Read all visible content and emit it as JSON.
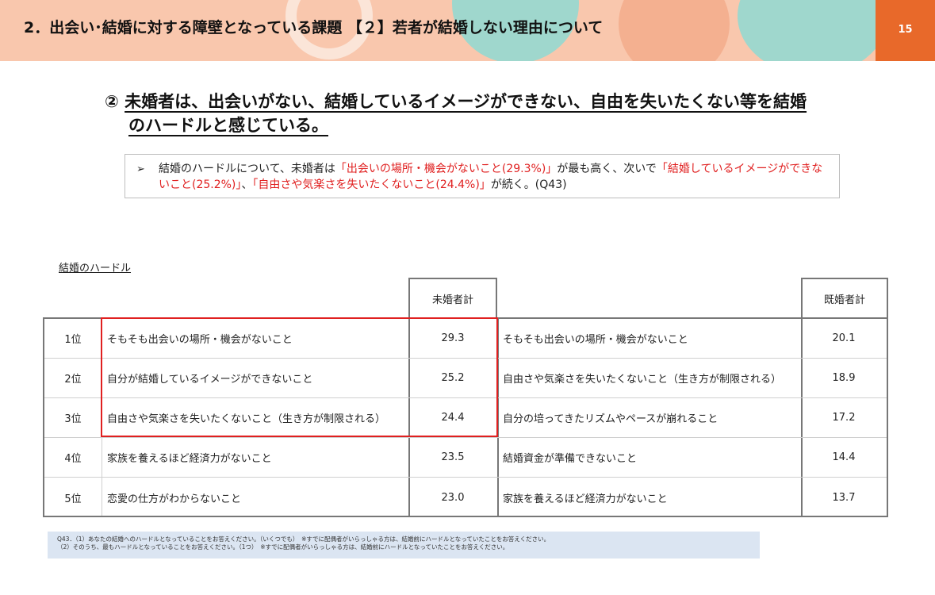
{
  "header": {
    "title": "2．出会い･結婚に対する障壁となっている課題 【２】若者が結婚しない理由について",
    "page_number": "15"
  },
  "headline": {
    "marker": "②",
    "line1": "未婚者は、出会いがない、結婚しているイメージができない、自由を失いたくない等を結婚",
    "line2": "のハードルと感じている。"
  },
  "bullet": {
    "arrow": "➢",
    "segments": [
      {
        "text": "結婚のハードルについて、未婚者は",
        "emphasis": false
      },
      {
        "text": "「出会いの場所・機会がないこと(29.3%)」",
        "emphasis": true
      },
      {
        "text": "が最も高く、次いで",
        "emphasis": false
      },
      {
        "text": "「結婚しているイメージができないこと(25.2%)」",
        "emphasis": true
      },
      {
        "text": "、",
        "emphasis": false
      },
      {
        "text": "「自由さや気楽さを失いたくないこと(24.4%)」",
        "emphasis": true
      },
      {
        "text": "が続く。(Q43)",
        "emphasis": false
      }
    ]
  },
  "table": {
    "caption": "結婚のハードル",
    "unmarried_header": "未婚者計",
    "married_header": "既婚者計",
    "rows": [
      {
        "rank": "1位",
        "reason_unmarried": "そもそも出会いの場所・機会がないこと",
        "value_unmarried": "29.3",
        "reason_married": "そもそも出会いの場所・機会がないこと",
        "value_married": "20.1"
      },
      {
        "rank": "2位",
        "reason_unmarried": "自分が結婚しているイメージができないこと",
        "value_unmarried": "25.2",
        "reason_married": "自由さや気楽さを失いたくないこと（生き方が制限される）",
        "value_married": "18.9"
      },
      {
        "rank": "3位",
        "reason_unmarried": "自由さや気楽さを失いたくないこと（生き方が制限される）",
        "value_unmarried": "24.4",
        "reason_married": "自分の培ってきたリズムやペースが崩れること",
        "value_married": "17.2"
      },
      {
        "rank": "4位",
        "reason_unmarried": "家族を養えるほど経済力がないこと",
        "value_unmarried": "23.5",
        "reason_married": "結婚資金が準備できないこと",
        "value_married": "14.4"
      },
      {
        "rank": "5位",
        "reason_unmarried": "恋愛の仕方がわからないこと",
        "value_unmarried": "23.0",
        "reason_married": "家族を養えるほど経済力がないこと",
        "value_married": "13.7"
      }
    ]
  },
  "footnote": {
    "line1": "Q43．（1）あなたの結婚へのハードルとなっていることをお答えください。（いくつでも）　※すでに配偶者がいらっしゃる方は、結婚前にハードルとなっていたことをお答えください。",
    "line2": "（2）そのうち、最もハードルとなっていることをお答えください。（1つ）　※すでに配偶者がいらっしゃる方は、結婚前にハードルとなっていたことをお答えください。"
  },
  "colors": {
    "header_bg": "#f9c7ad",
    "accent_orange": "#e8692a",
    "teal_decor": "#9fd7cd",
    "emphasis_red": "#e02020",
    "footnote_bg": "#dbe5f2"
  }
}
